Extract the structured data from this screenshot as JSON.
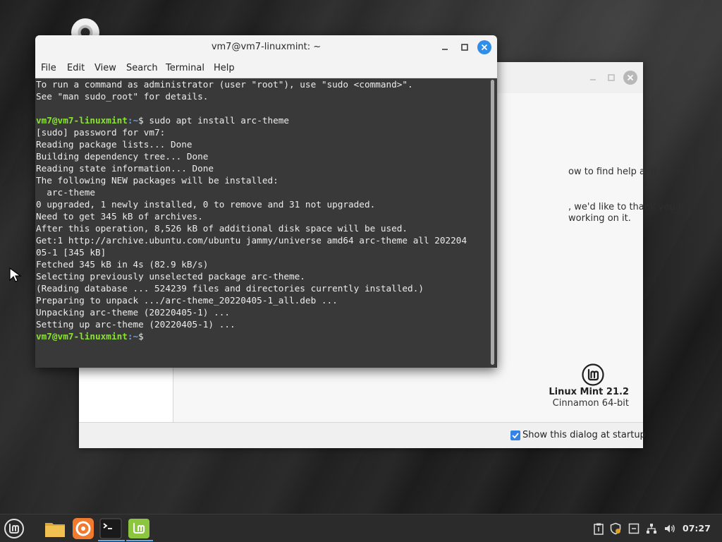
{
  "terminal": {
    "title": "vm7@vm7-linuxmint: ~",
    "menu": [
      "File",
      "Edit",
      "View",
      "Search",
      "Terminal",
      "Help"
    ],
    "lines": [
      "To run a command as administrator (user \"root\"), use \"sudo <command>\".",
      "See \"man sudo_root\" for details.",
      "",
      "",
      "[sudo] password for vm7:",
      "Reading package lists... Done",
      "Building dependency tree... Done",
      "Reading state information... Done",
      "The following NEW packages will be installed:",
      "  arc-theme",
      "0 upgraded, 1 newly installed, 0 to remove and 31 not upgraded.",
      "Need to get 345 kB of archives.",
      "After this operation, 8,526 kB of additional disk space will be used.",
      "Get:1 http://archive.ubuntu.com/ubuntu jammy/universe amd64 arc-theme all 202204",
      "05-1 [345 kB]",
      "Fetched 345 kB in 4s (82.9 kB/s)",
      "Selecting previously unselected package arc-theme.",
      "(Reading database ... 524239 files and directories currently installed.)",
      "Preparing to unpack .../arc-theme_20220405-1_all.deb ...",
      "Unpacking arc-theme (20220405-1) ...",
      "Setting up arc-theme (20220405-1) ..."
    ],
    "prompt_user": "vm7@vm7-linuxmint",
    "prompt_path": ":~",
    "prompt_symbol": "$",
    "command": " sudo apt install arc-theme"
  },
  "welcome": {
    "text_line1": "ow to find help and where to",
    "text_line2": ", we'd like to thank you for",
    "text_line3": "working on it.",
    "product_name": "Linux Mint 21.2",
    "edition": "Cinnamon 64-bit",
    "startup_checkbox_label": "Show this dialog at startup",
    "startup_checked": true
  },
  "taskbar": {
    "clock": "07:27",
    "launchers": [
      "mint-menu-icon",
      "files-icon",
      "firefox-icon",
      "terminal-icon",
      "welcome-icon"
    ],
    "tray": [
      "clipboard-icon",
      "shield-icon",
      "update-icon",
      "network-icon",
      "volume-icon"
    ]
  },
  "colors": {
    "terminal_bg": "#393939",
    "prompt_green": "#8ae234",
    "prompt_blue": "#729fcf",
    "accent_blue": "#2f8ee8",
    "mint_green": "#8cc63f"
  }
}
